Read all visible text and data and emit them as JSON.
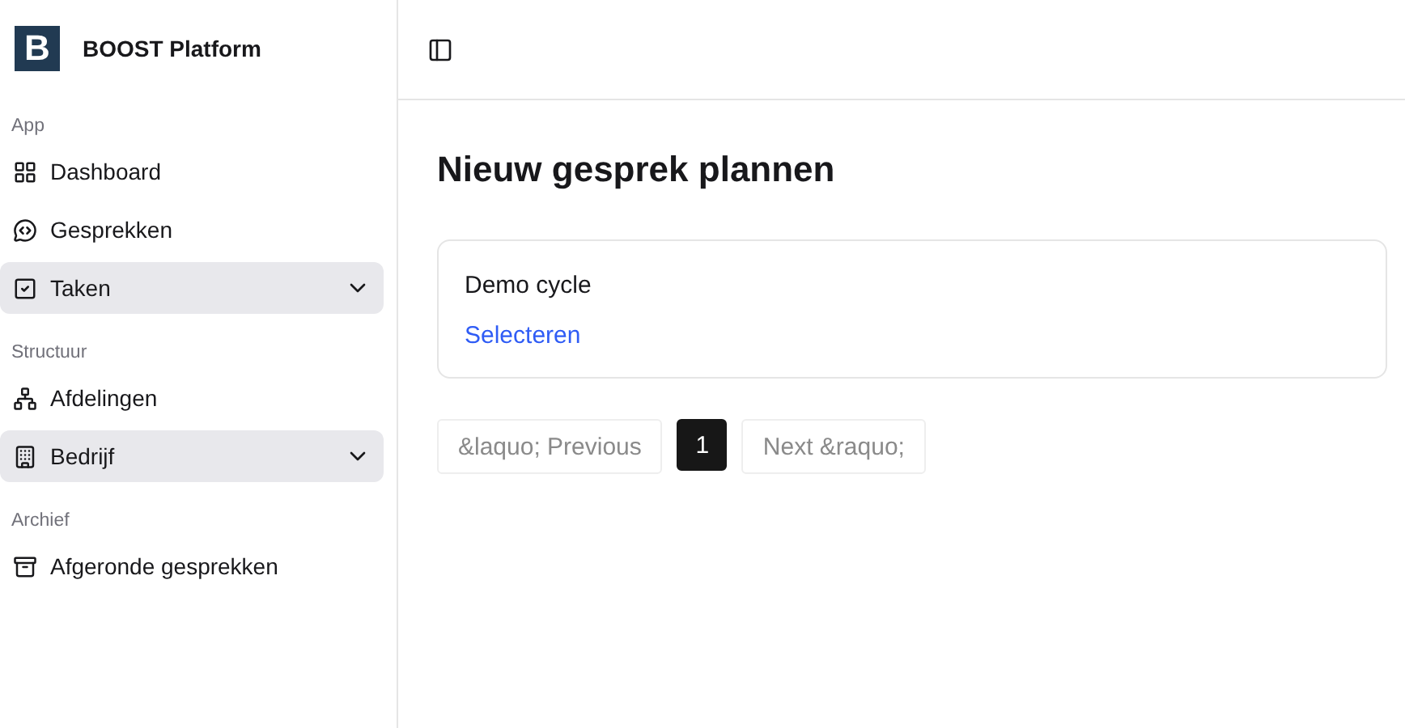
{
  "sidebar": {
    "brand": {
      "logo_letter": "B",
      "title": "BOOST Platform"
    },
    "sections": [
      {
        "label": "App",
        "items": [
          {
            "label": "Dashboard",
            "kind": "link"
          },
          {
            "label": "Gesprekken",
            "kind": "link"
          },
          {
            "label": "Taken",
            "kind": "collapsible"
          }
        ]
      },
      {
        "label": "Structuur",
        "items": [
          {
            "label": "Afdelingen",
            "kind": "link"
          },
          {
            "label": "Bedrijf",
            "kind": "collapsible"
          }
        ]
      },
      {
        "label": "Archief",
        "items": [
          {
            "label": "Afgeronde gesprekken",
            "kind": "link"
          }
        ]
      }
    ]
  },
  "main": {
    "title": "Nieuw gesprek plannen",
    "cards": [
      {
        "title": "Demo cycle",
        "action": "Selecteren"
      }
    ],
    "pagination": {
      "previous": {
        "label": "&laquo; Previous",
        "disabled": true
      },
      "pages": [
        {
          "label": "1",
          "selected": true
        }
      ],
      "next": {
        "label": "Next &raquo;",
        "disabled": true
      }
    }
  }
}
